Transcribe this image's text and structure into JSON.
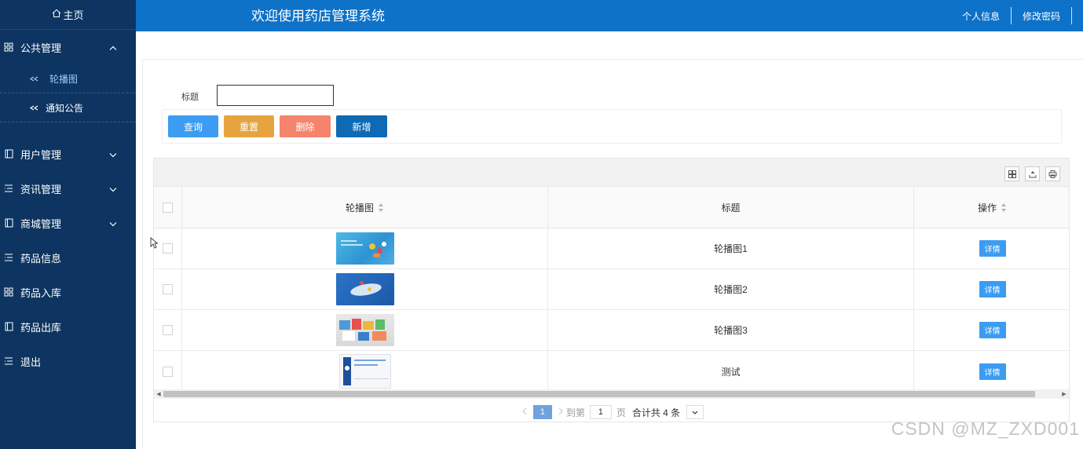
{
  "sidebar": {
    "home": "主页",
    "group_public": "公共管理",
    "sub_items": [
      "轮播图",
      "通知公告"
    ],
    "items": [
      "用户管理",
      "资讯管理",
      "商城管理",
      "药品信息",
      "药品入库",
      "药品出库",
      "退出"
    ]
  },
  "header": {
    "title": "欢迎使用药店管理系统",
    "profile": "个人信息",
    "change_password": "修改密码"
  },
  "search": {
    "label": "标题",
    "value": ""
  },
  "buttons": {
    "query": "查询",
    "reset": "重置",
    "delete": "删除",
    "add": "新增"
  },
  "table": {
    "columns": [
      "轮播图",
      "标题",
      "操作"
    ],
    "rows": [
      {
        "title": "轮播图1",
        "action": "详情"
      },
      {
        "title": "轮播图2",
        "action": "详情"
      },
      {
        "title": "轮播图3",
        "action": "详情"
      },
      {
        "title": "测试",
        "action": "详情"
      }
    ]
  },
  "pager": {
    "current": "1",
    "goto": "到第",
    "page_input": "1",
    "page": "页",
    "total": "合计共 4 条"
  },
  "watermark": "CSDN @MZ_ZXD001",
  "colors": {
    "sidebar_bg": "#0e3561",
    "header_bg": "#0e72c8",
    "btn_query": "#3b9cf2",
    "btn_reset": "#e6a441",
    "btn_delete": "#f4846b",
    "btn_add": "#0e6ab4"
  }
}
